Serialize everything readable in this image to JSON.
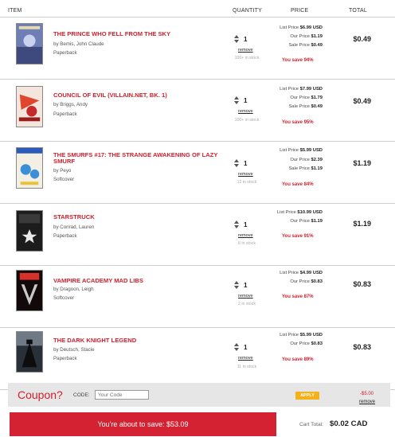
{
  "header": {
    "item": "ITEM",
    "quantity": "QUANTITY",
    "price": "PRICE",
    "total": "TOTAL"
  },
  "labels": {
    "list_price": "List Price",
    "our_price": "Our Price",
    "sale_price": "Sale Price",
    "remove": "remove"
  },
  "items": [
    {
      "title": "THE PRINCE WHO FELL FROM THE SKY",
      "author": "by Bemis, John Claude",
      "format": "Paperback",
      "qty": "1",
      "stock": "100+ in stock",
      "list_price": "$6.99 USD",
      "our_price": "$1.19",
      "sale_price": "$0.49",
      "save": "You save 94%",
      "total": "$0.49",
      "cover_icon": "book-cover-image"
    },
    {
      "title": "COUNCIL OF EVIL (VILLAIN.NET, BK. 1)",
      "author": "by Briggs, Andy",
      "format": "Paperback",
      "qty": "1",
      "stock": "100+ in stock",
      "list_price": "$7.99 USD",
      "our_price": "$1.79",
      "sale_price": "$0.49",
      "save": "You save 95%",
      "total": "$0.49",
      "cover_icon": "book-cover-image"
    },
    {
      "title": "THE SMURFS #17: THE STRANGE AWAKENING OF LAZY SMURF",
      "author": "by Peyo",
      "format": "Softcover",
      "qty": "1",
      "stock": "12 in stock",
      "list_price": "$5.99 USD",
      "our_price": "$2.39",
      "sale_price": "$1.19",
      "save": "You save 84%",
      "total": "$1.19",
      "cover_icon": "book-cover-image"
    },
    {
      "title": "STARSTRUCK",
      "author": "by Conrad, Lauren",
      "format": "Paperback",
      "qty": "1",
      "stock": "8 in stock",
      "list_price": "$10.99 USD",
      "our_price": "$1.19",
      "save": "You save 91%",
      "total": "$1.19",
      "cover_icon": "book-cover-image"
    },
    {
      "title": "VAMPIRE ACADEMY MAD LIBS",
      "author": "by Dragoon, Leigh",
      "format": "Softcover",
      "qty": "1",
      "stock": "2 in stock",
      "list_price": "$4.99 USD",
      "our_price": "$0.83",
      "save": "You save 87%",
      "total": "$0.83",
      "cover_icon": "book-cover-image"
    },
    {
      "title": "THE DARK KNIGHT LEGEND",
      "author": "by Deutsch, Stacie",
      "format": "Paperback",
      "qty": "1",
      "stock": "11 in stock",
      "list_price": "$5.99 USD",
      "our_price": "$0.83",
      "save": "You save 89%",
      "total": "$0.83",
      "cover_icon": "book-cover-image"
    }
  ],
  "coupon": {
    "title": "Coupon?",
    "code_label": "CODE:",
    "placeholder": "Your Code",
    "apply": "APPLY",
    "amount": "-$5.00",
    "remove": "remove"
  },
  "summary": {
    "save_banner": "You're about to save: $53.09",
    "cart_total_label": "Cart Total:",
    "cart_total_value": "$0.02 CAD"
  },
  "colors": {
    "accent": "#d0202e",
    "banner": "#d42233",
    "apply": "#f3b11c"
  }
}
